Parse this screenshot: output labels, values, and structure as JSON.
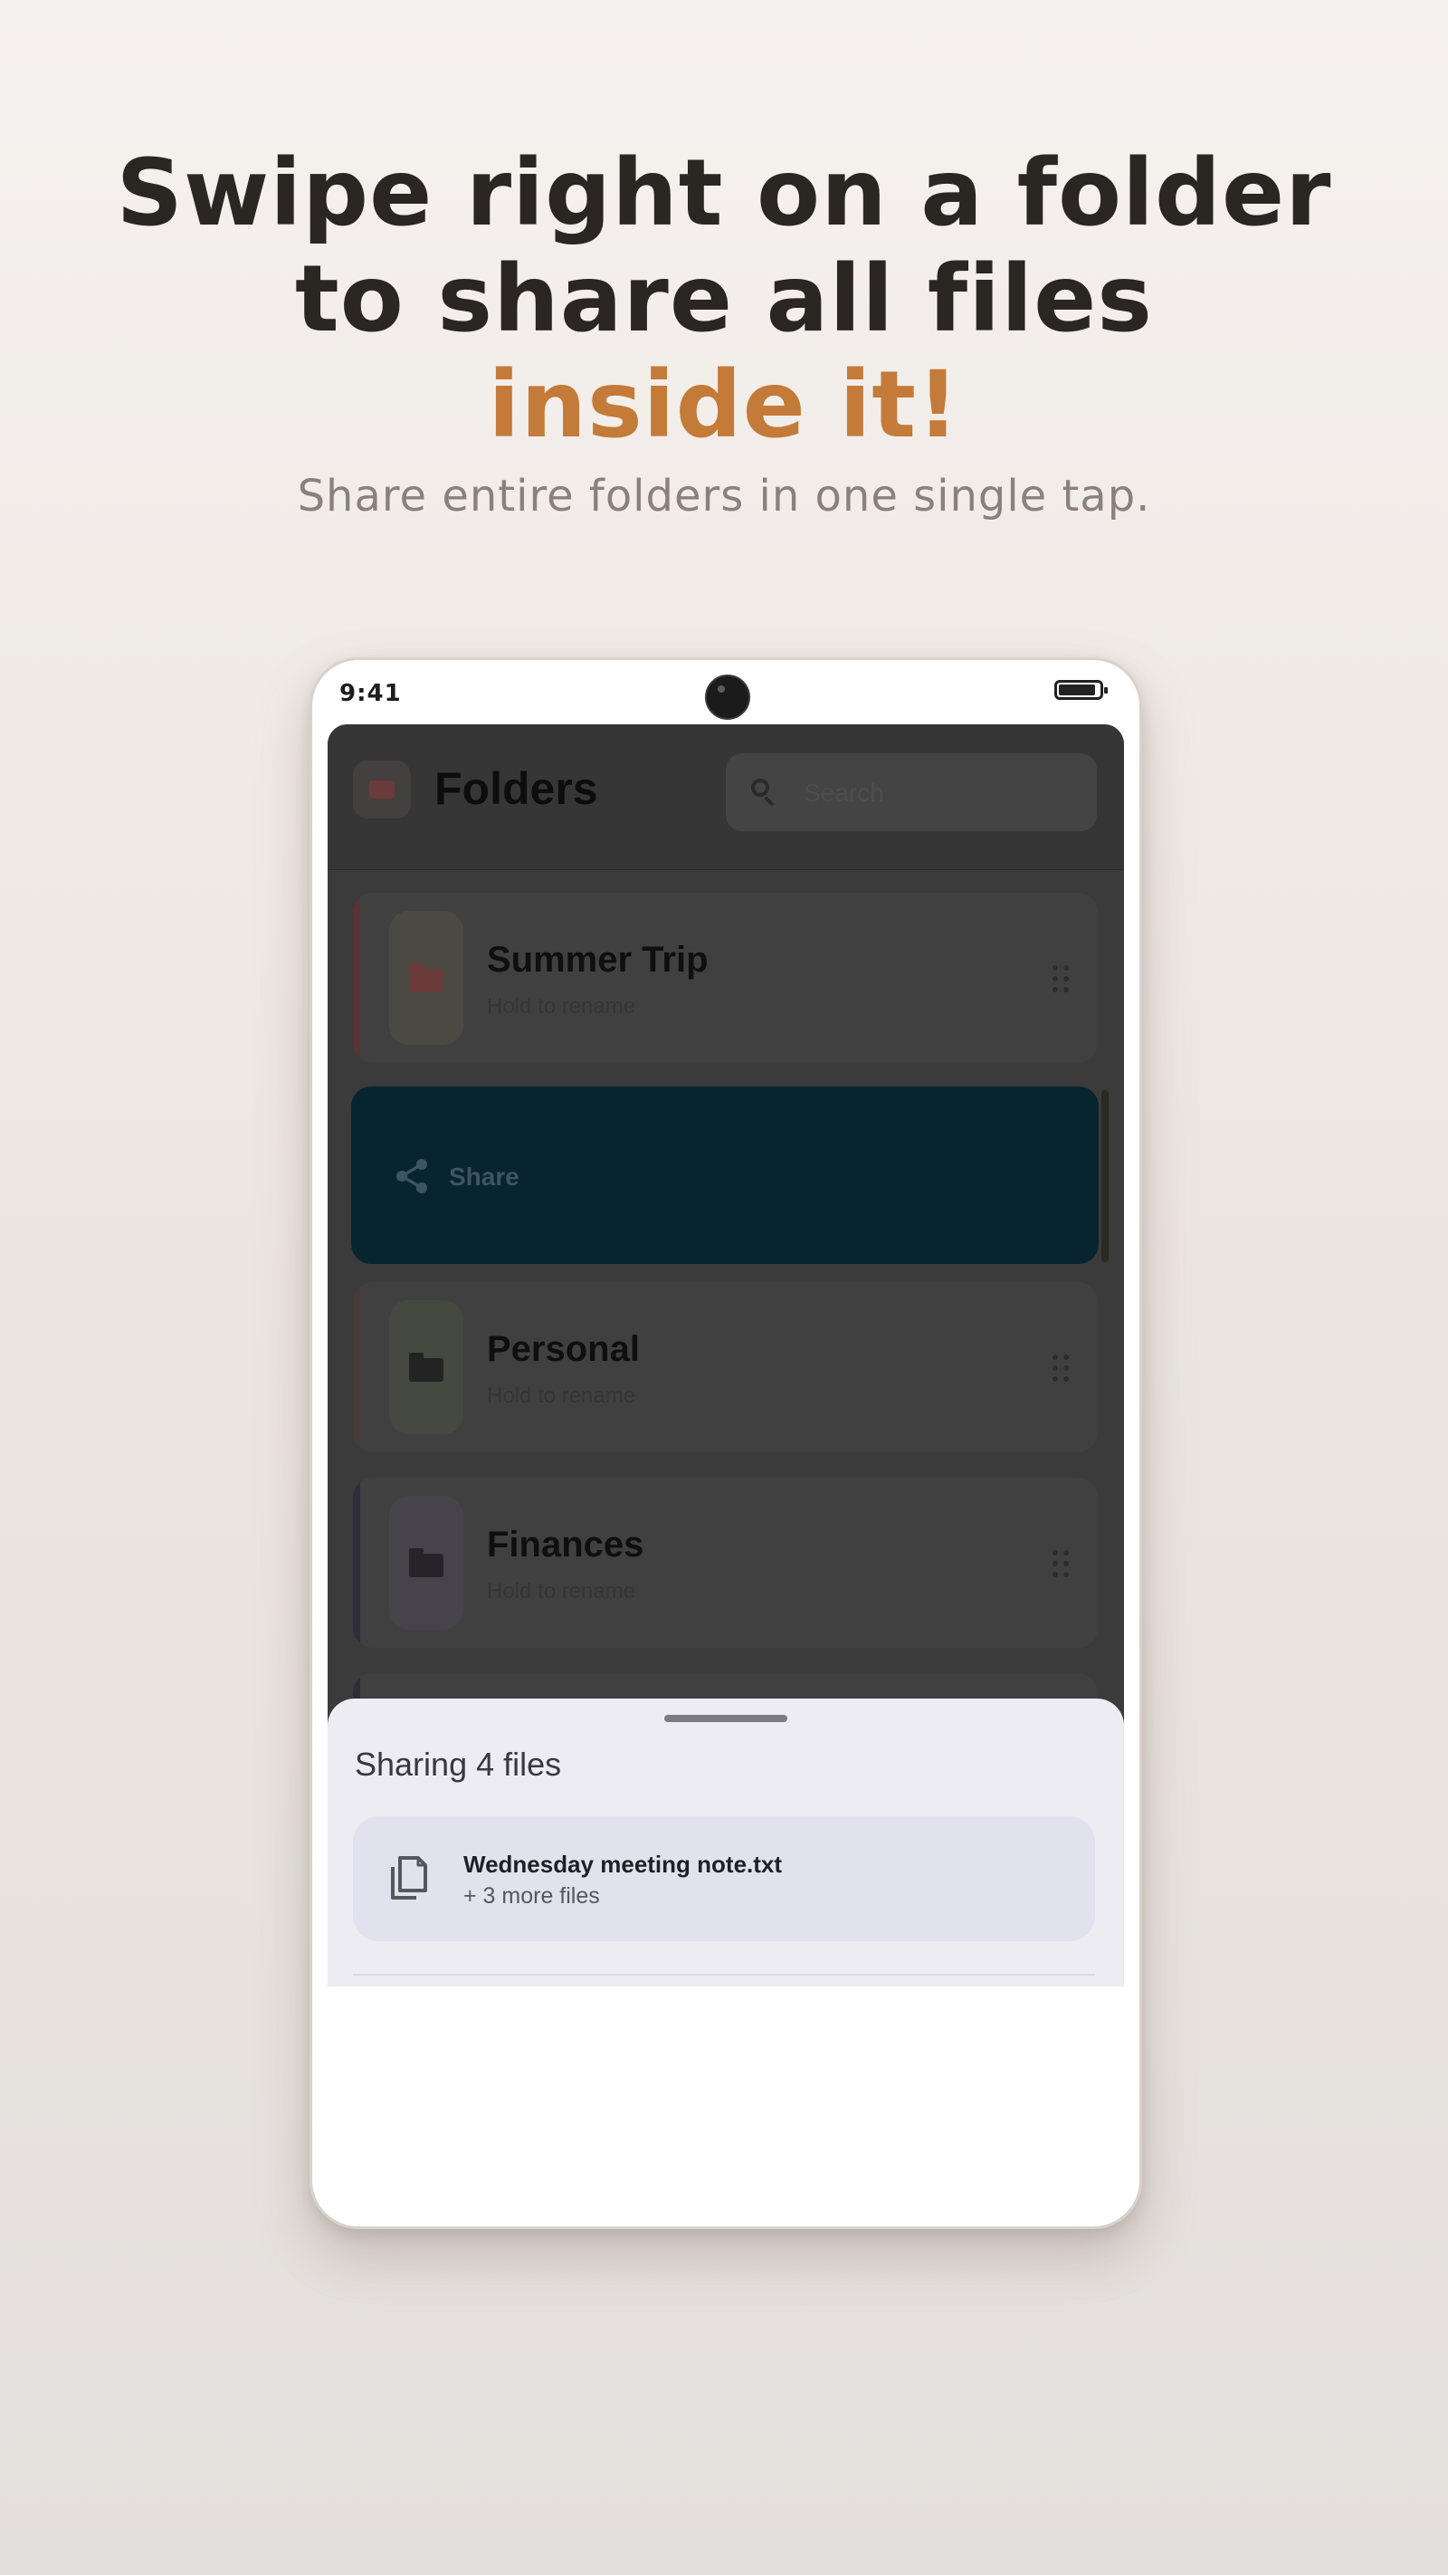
{
  "promo": {
    "headline_line1": "Swipe right on a folder",
    "headline_line2": "to share all files",
    "headline_accent": "inside it!",
    "subheadline": "Share entire folders in one single tap.",
    "accent_color": "#c47a38"
  },
  "device": {
    "status_time": "9:41"
  },
  "app": {
    "title": "Folders",
    "search_placeholder": "Search",
    "folders": [
      {
        "name": "Summer Trip",
        "hint": "Hold to rename",
        "color": "#6b3a3a",
        "thumb_bg": "#4a4a42"
      },
      {
        "name": "Personal",
        "hint": "Hold to rename",
        "color": "#232323",
        "thumb_bg": "#45493f"
      },
      {
        "name": "Finances",
        "hint": "Hold to rename",
        "color": "#262429",
        "thumb_bg": "#47434a"
      }
    ],
    "swipe_action": {
      "label": "Share",
      "icon": "share-icon",
      "color": "#08242e"
    }
  },
  "share_sheet": {
    "title": "Sharing 4 files",
    "file_name": "Wednesday meeting note.txt",
    "more_files": "+ 3 more files",
    "file_icon": "copy-files-icon"
  }
}
